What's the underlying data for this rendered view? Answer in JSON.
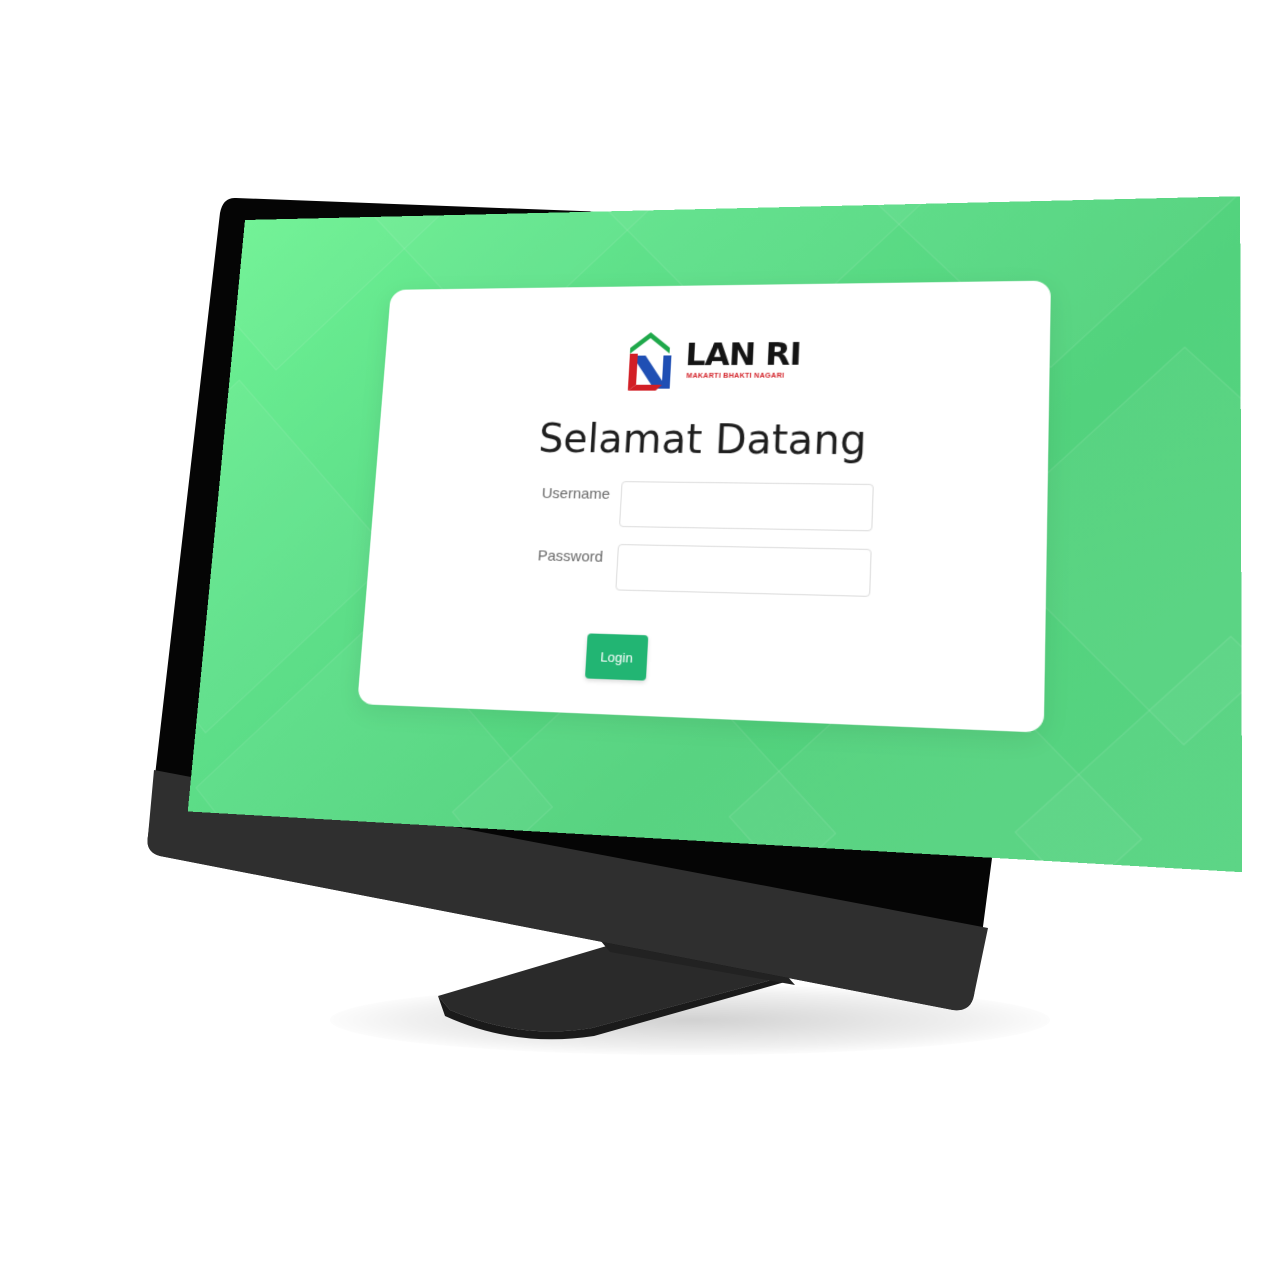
{
  "login": {
    "brand_name": "LAN RI",
    "brand_tagline": "MAKARTI BHAKTI NAGARI",
    "title": "Selamat Datang",
    "username_label": "Username",
    "username_value": "",
    "password_label": "Password",
    "password_value": "",
    "submit_label": "Login"
  },
  "colors": {
    "background_green": "#5cdc86",
    "button_green": "#22b573",
    "logo_green": "#1ea84a",
    "logo_red": "#d21f26",
    "logo_blue": "#1f4fb4"
  },
  "icons": {
    "logo": "lan-ri-logo-icon"
  }
}
